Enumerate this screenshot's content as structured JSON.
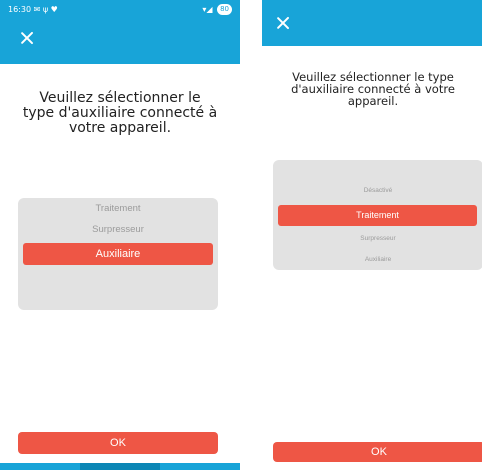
{
  "left_screen": {
    "status_bar": {
      "time": "16:30",
      "icons": "✉ ψ ♥",
      "signal": "▾◢",
      "battery": "80"
    },
    "prompt": "Veuillez sélectionner le type d'auxiliaire connecté à votre appareil.",
    "options": [
      "Traitement",
      "Surpresseur",
      "Auxiliaire"
    ],
    "selected": "Auxiliaire",
    "ok_label": "OK",
    "close_icon": "close-icon"
  },
  "right_screen": {
    "prompt": "Veuillez sélectionner le type d'auxiliaire connecté à votre appareil.",
    "options": [
      "Désactivé",
      "Traitement",
      "Surpresseur",
      "Auxiliaire"
    ],
    "selected": "Traitement",
    "ok_label": "OK",
    "close_icon": "close-icon"
  },
  "colors": {
    "header": "#18a4d8",
    "accent": "#ee5645",
    "picker_bg": "#e2e2e2",
    "muted_text": "#9b9b9b"
  }
}
